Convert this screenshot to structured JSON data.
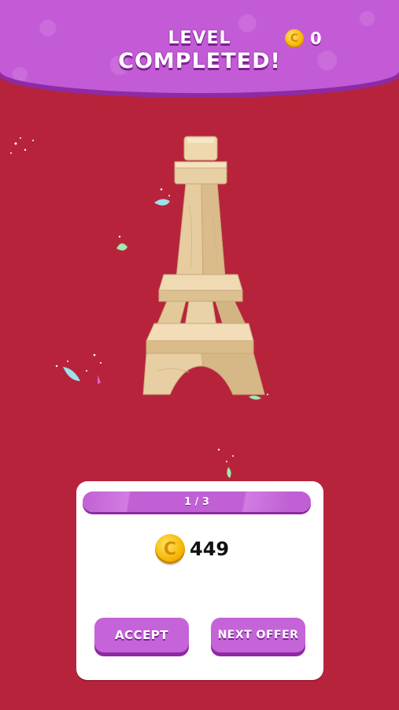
{
  "header": {
    "title_line1": "LEVEL",
    "title_line2": "COMPLETED!",
    "coin_balance": "0",
    "coin_glyph": "C"
  },
  "offer": {
    "progress_label": "1 / 3",
    "reward_amount": "449",
    "coin_glyph": "C",
    "accept_label": "ACCEPT",
    "next_label": "NEXT OFFER"
  },
  "colors": {
    "background": "#b8233c",
    "header": "#c45bd6",
    "button": "#c564d8",
    "coin": "#f5b400"
  }
}
